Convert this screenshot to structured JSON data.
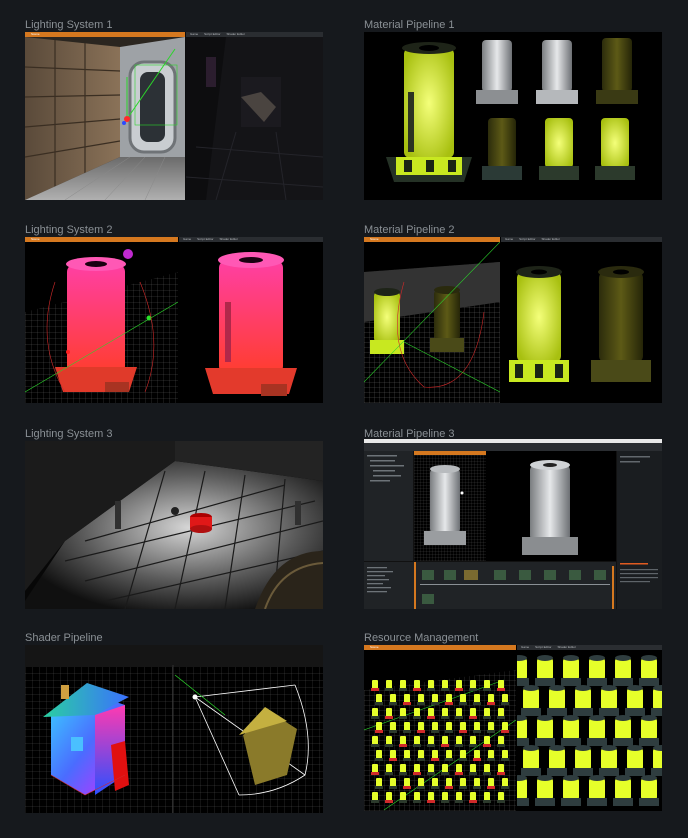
{
  "gallery": {
    "cards": [
      {
        "title": "Lighting System 1"
      },
      {
        "title": "Material Pipeline 1"
      },
      {
        "title": "Lighting System 2"
      },
      {
        "title": "Material Pipeline 2"
      },
      {
        "title": "Lighting System 3"
      },
      {
        "title": "Material Pipeline 3"
      },
      {
        "title": "Shader Pipeline"
      },
      {
        "title": "Resource Management"
      }
    ]
  },
  "editor": {
    "scene_tab": "Scene",
    "game_tab": "Game",
    "script_tab": "Script Editor",
    "shader_tab": "Shader Editor"
  },
  "colors": {
    "background": "#16191d",
    "title_text": "#8a9095",
    "editor_bar": "#d5781f",
    "glow_yellow": "#e6ff2a",
    "gradient_pink": "#ff3fa4",
    "gradient_red": "#ff3d2e"
  }
}
